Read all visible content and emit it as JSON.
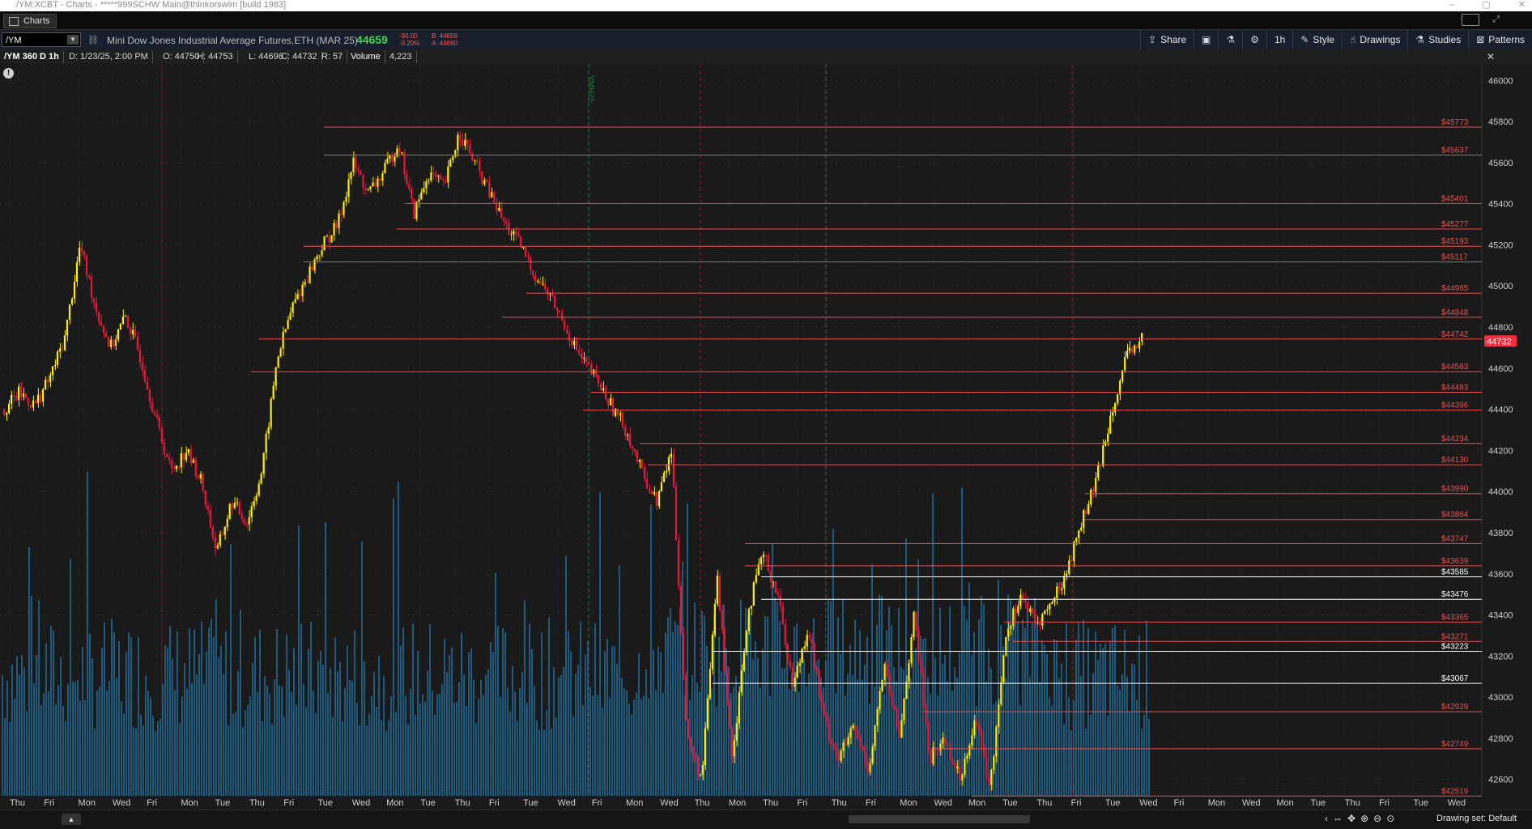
{
  "window": {
    "title": "/YM:XCBT - Charts - *****999SCHW Main@thinkorswim [build 1983]",
    "controls": [
      "–",
      "▢",
      "✕"
    ]
  },
  "tabs": [
    {
      "label": "Charts"
    }
  ],
  "toolbar": {
    "symbol": "/YM",
    "description": "Mini Dow Jones Industrial Average Futures,ETH (MAR 25)",
    "last_price": "44659",
    "net_change": "-90.00",
    "pct_change": "-0.20%",
    "bid": "B: 44658",
    "ask": "A: 44660",
    "buttons": {
      "share": "Share",
      "interval": "1h",
      "style": "Style",
      "drawings": "Drawings",
      "studies": "Studies",
      "patterns": "Patterns"
    }
  },
  "infobar": {
    "chart_label": "/YM 360 D 1h",
    "date": "D: 1/23/25, 2:00 PM",
    "open": "O: 44750",
    "high": "H: 44753",
    "low": "L: 44696",
    "close": "C: 44732",
    "range": "R: 57",
    "volume_label": "Volume",
    "volume_value": "4,223"
  },
  "footer": {
    "drawing_set": "Drawing set: Default"
  },
  "colors": {
    "background": "#1a1a1a",
    "up_candle": "#ffee00",
    "down_candle": "#e8173a",
    "volume": "#1e5a7e",
    "level_red": "#e85050",
    "level_white": "#ffffff",
    "price_badge": "#ff2a3a",
    "gain_green": "#3dd84a"
  },
  "chart_data": {
    "type": "candlestick",
    "ylim": [
      42520,
      46080
    ],
    "y_ticks": [
      42600,
      42800,
      43000,
      43200,
      43400,
      43600,
      43800,
      44000,
      44200,
      44400,
      44600,
      44800,
      45000,
      45200,
      45400,
      45600,
      45800,
      46000
    ],
    "x_labels": [
      "Thu",
      "Fri",
      "Mon",
      "Wed",
      "Fri",
      "Mon",
      "Tue",
      "Thu",
      "Fri",
      "Tue",
      "Wed",
      "Mon",
      "Tue",
      "Thu",
      "Fri",
      "Tue",
      "Wed",
      "Fri",
      "Mon",
      "Wed",
      "Thu",
      "Mon",
      "Thu",
      "Fri",
      "Thu",
      "Fri",
      "Mon",
      "Wed",
      "Mon",
      "Tue",
      "Thu",
      "Fri",
      "Tue",
      "Wed",
      "Fri",
      "Mon",
      "Wed",
      "Mon",
      "Tue",
      "Thu",
      "Fri",
      "Tue",
      "Wed"
    ],
    "contract_marker": "YMH25",
    "current_price": 44732,
    "levels": [
      {
        "label": "$45773",
        "value": 45773,
        "color": "red"
      },
      {
        "label": "$45637",
        "value": 45637,
        "color": "red"
      },
      {
        "label": "$45401",
        "value": 45401,
        "color": "red"
      },
      {
        "label": "$45277",
        "value": 45277,
        "color": "red"
      },
      {
        "label": "$45193",
        "value": 45193,
        "color": "red"
      },
      {
        "label": "$45117",
        "value": 45117,
        "color": "red"
      },
      {
        "label": "$44965",
        "value": 44965,
        "color": "red"
      },
      {
        "label": "$44848",
        "value": 44848,
        "color": "red"
      },
      {
        "label": "$44742",
        "value": 44742,
        "color": "red"
      },
      {
        "label": "$44583",
        "value": 44583,
        "color": "red"
      },
      {
        "label": "$44483",
        "value": 44483,
        "color": "red"
      },
      {
        "label": "$44396",
        "value": 44396,
        "color": "red"
      },
      {
        "label": "$44234",
        "value": 44234,
        "color": "red"
      },
      {
        "label": "$44130",
        "value": 44130,
        "color": "red"
      },
      {
        "label": "$43990",
        "value": 43990,
        "color": "red"
      },
      {
        "label": "$43864",
        "value": 43864,
        "color": "red"
      },
      {
        "label": "$43747",
        "value": 43747,
        "color": "red"
      },
      {
        "label": "$43639",
        "value": 43639,
        "color": "red"
      },
      {
        "label": "$43585",
        "value": 43585,
        "color": "white"
      },
      {
        "label": "$43476",
        "value": 43476,
        "color": "white"
      },
      {
        "label": "$43365",
        "value": 43365,
        "color": "red"
      },
      {
        "label": "$43271",
        "value": 43271,
        "color": "red"
      },
      {
        "label": "$43223",
        "value": 43223,
        "color": "white"
      },
      {
        "label": "$43067",
        "value": 43067,
        "color": "white"
      },
      {
        "label": "$42929",
        "value": 42929,
        "color": "red"
      },
      {
        "label": "$42749",
        "value": 42749,
        "color": "red"
      },
      {
        "label": "$42519",
        "value": 42519,
        "color": "red"
      }
    ],
    "price_path": [
      44400,
      44480,
      44420,
      44550,
      44750,
      45200,
      44900,
      44700,
      44850,
      44650,
      44350,
      44100,
      44200,
      44050,
      43700,
      43950,
      43850,
      44100,
      44650,
      44900,
      45050,
      45200,
      45300,
      45600,
      45450,
      45550,
      45700,
      45350,
      45550,
      45480,
      45750,
      45600,
      45450,
      45300,
      45200,
      45050,
      44950,
      44800,
      44650,
      44550,
      44420,
      44300,
      44100,
      43950,
      44200,
      42800,
      42600,
      43600,
      42700,
      43400,
      43700,
      43500,
      43050,
      43350,
      42900,
      42700,
      42850,
      42650,
      43150,
      42800,
      43400,
      42700,
      42800,
      42600,
      42900,
      42550,
      43300,
      43500,
      43350,
      43450,
      43600,
      43850,
      44050,
      44400,
      44650,
      44750
    ]
  }
}
